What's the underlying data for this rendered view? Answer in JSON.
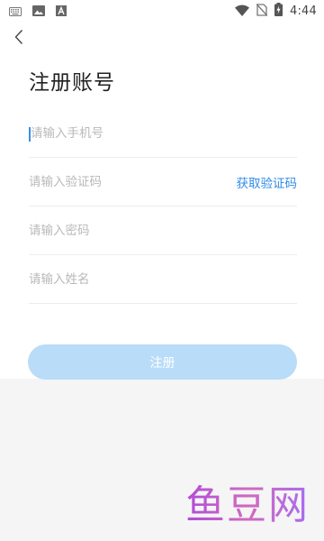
{
  "status_bar": {
    "time": "4:44",
    "left_icons": [
      "keyboard-icon",
      "image-icon",
      "font-icon"
    ],
    "right_icons": [
      "wifi-icon",
      "no-sim-icon",
      "battery-charging-icon"
    ]
  },
  "nav": {
    "back_icon": "chevron-left-icon"
  },
  "page": {
    "title": "注册账号"
  },
  "form": {
    "phone": {
      "placeholder": "请输入手机号",
      "value": ""
    },
    "code": {
      "placeholder": "请输入验证码",
      "value": "",
      "action_label": "获取验证码"
    },
    "password": {
      "placeholder": "请输入密码",
      "value": ""
    },
    "name": {
      "placeholder": "请输入姓名",
      "value": ""
    }
  },
  "submit": {
    "label": "注册"
  },
  "watermark": {
    "text": "鱼豆网"
  },
  "colors": {
    "link": "#2f8be6",
    "button_disabled": "#b9dcf8",
    "caret": "#3a8ee6",
    "bottom_bg": "#f5f5f5"
  }
}
